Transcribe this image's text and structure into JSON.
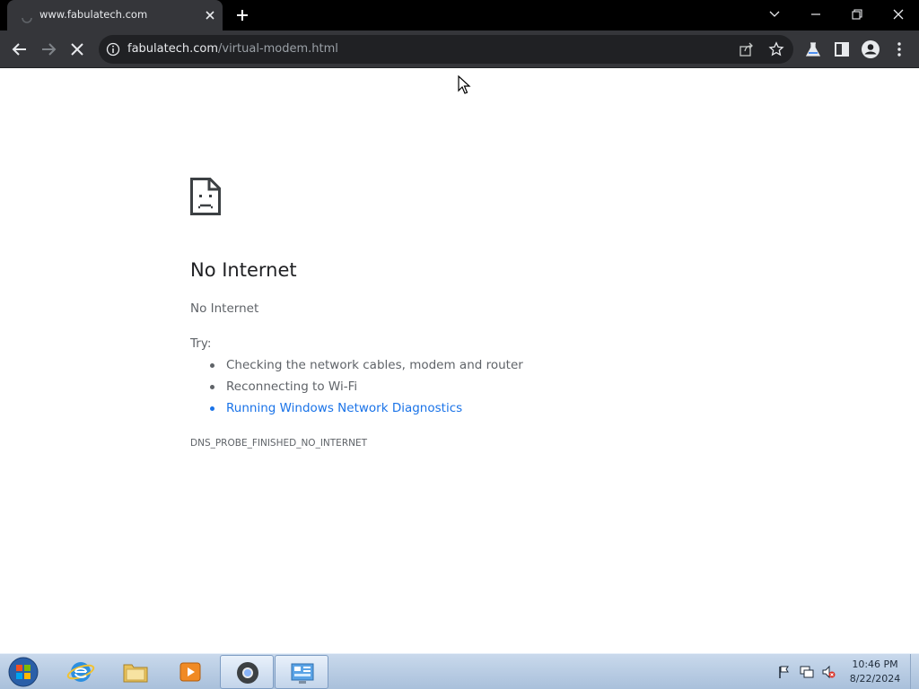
{
  "tab": {
    "title": "www.fabulatech.com"
  },
  "toolbar": {
    "url_host": "fabulatech.com",
    "url_path": "/virtual-modem.html"
  },
  "page": {
    "heading": "No Internet",
    "subheading": "No Internet",
    "try_label": "Try:",
    "suggestions": [
      "Checking the network cables, modem and router",
      "Reconnecting to Wi-Fi",
      "Running Windows Network Diagnostics"
    ],
    "error_code": "DNS_PROBE_FINISHED_NO_INTERNET"
  },
  "taskbar": {
    "time": "10:46 PM",
    "date": "8/22/2024"
  },
  "colors": {
    "link": "#1a73e8",
    "chrome_dark": "#35363a",
    "taskbar": "#b8cce4"
  }
}
